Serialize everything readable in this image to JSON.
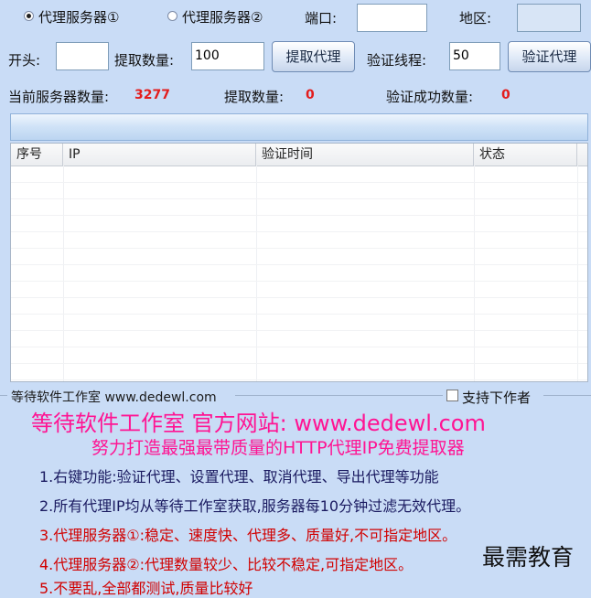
{
  "toolbar": {
    "radio1_label": "代理服务器①",
    "radio2_label": "代理服务器②",
    "port_label": "端口:",
    "port_value": "",
    "region_label": "地区:",
    "region_value": ""
  },
  "fetch": {
    "prefix_label": "开头:",
    "prefix_value": "",
    "count_label": "提取数量:",
    "count_value": "100",
    "fetch_button": "提取代理",
    "threads_label": "验证线程:",
    "threads_value": "50",
    "verify_button": "验证代理"
  },
  "stats": {
    "server_count_label": "当前服务器数量:",
    "server_count_value": "3277",
    "fetched_label": "提取数量:",
    "fetched_value": "0",
    "verified_label": "验证成功数量:",
    "verified_value": "0"
  },
  "progress": {
    "fraction": 0
  },
  "table": {
    "columns": [
      "序号",
      "IP",
      "验证时间",
      "状态"
    ],
    "rows": []
  },
  "info": {
    "group_title": "等待软件工作室 www.dedewl.com",
    "support_label": "支持下作者",
    "support_checked": false,
    "headline": "等待软件工作室 官方网站: www.dedewl.com",
    "slogan": "努力打造最强最带质量的HTTP代理IP免费提取器",
    "notes": [
      "1.右键功能:验证代理、设置代理、取消代理、导出代理等功能",
      "2.所有代理IP均从等待工作室获取,服务器每10分钟过滤无效代理。",
      "3.代理服务器①:稳定、速度快、代理多、质量好,不可指定地区。",
      "4.代理服务器②:代理数量较少、比较不稳定,可指定地区。",
      "5.不要乱,全部都测试,质量比较好"
    ]
  },
  "watermark": "最需教育",
  "colors": {
    "background": "#c9dcf6",
    "accent_pink": "#ff1493",
    "stat_red": "#e31c1c",
    "note_red": "#d10000"
  }
}
